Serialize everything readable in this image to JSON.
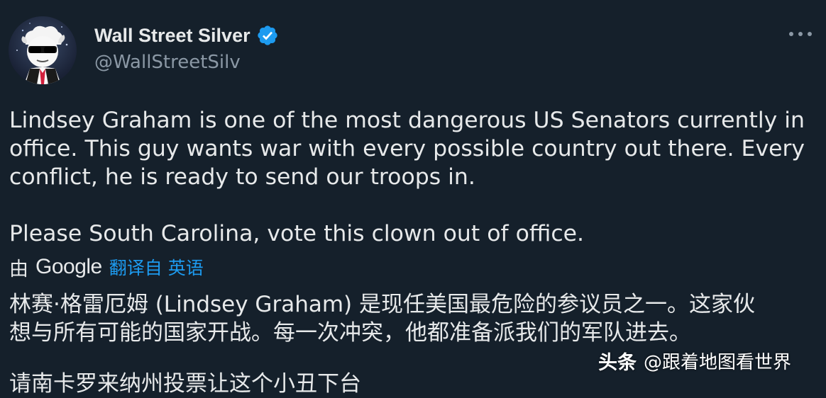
{
  "tweet": {
    "author": {
      "display_name": "Wall Street Silver",
      "handle": "@WallStreetSilv",
      "verified": true,
      "avatar_icon": "wall-street-bets-mascot-avatar"
    },
    "more_icon": "more-horizontal-icon",
    "text_lines": [
      "Lindsey Graham is one of the most dangerous US Senators currently in",
      "office. This guy wants war with every possible country out there. Every",
      "conflict, he is ready to send our troops in.",
      "Please South Carolina, vote this clown out of office."
    ],
    "translation": {
      "by_label": "由",
      "provider": "Google",
      "translated_from": "翻译自 英语",
      "text_lines": [
        "林赛·格雷厄姆 (Lindsey Graham) 是现任美国最危险的参议员之一。这家伙",
        "想与所有可能的国家开战。每一次冲突，他都准备派我们的军队进去。",
        "请南卡罗来纳州投票让这个小丑下台"
      ]
    }
  },
  "watermark": {
    "logo": "头条",
    "account": "@跟着地图看世界"
  },
  "colors": {
    "background": "#15202b",
    "text": "#e7e9ea",
    "secondary": "#8b98a5",
    "link": "#1d9bf0",
    "verified": "#1d9bf0"
  }
}
